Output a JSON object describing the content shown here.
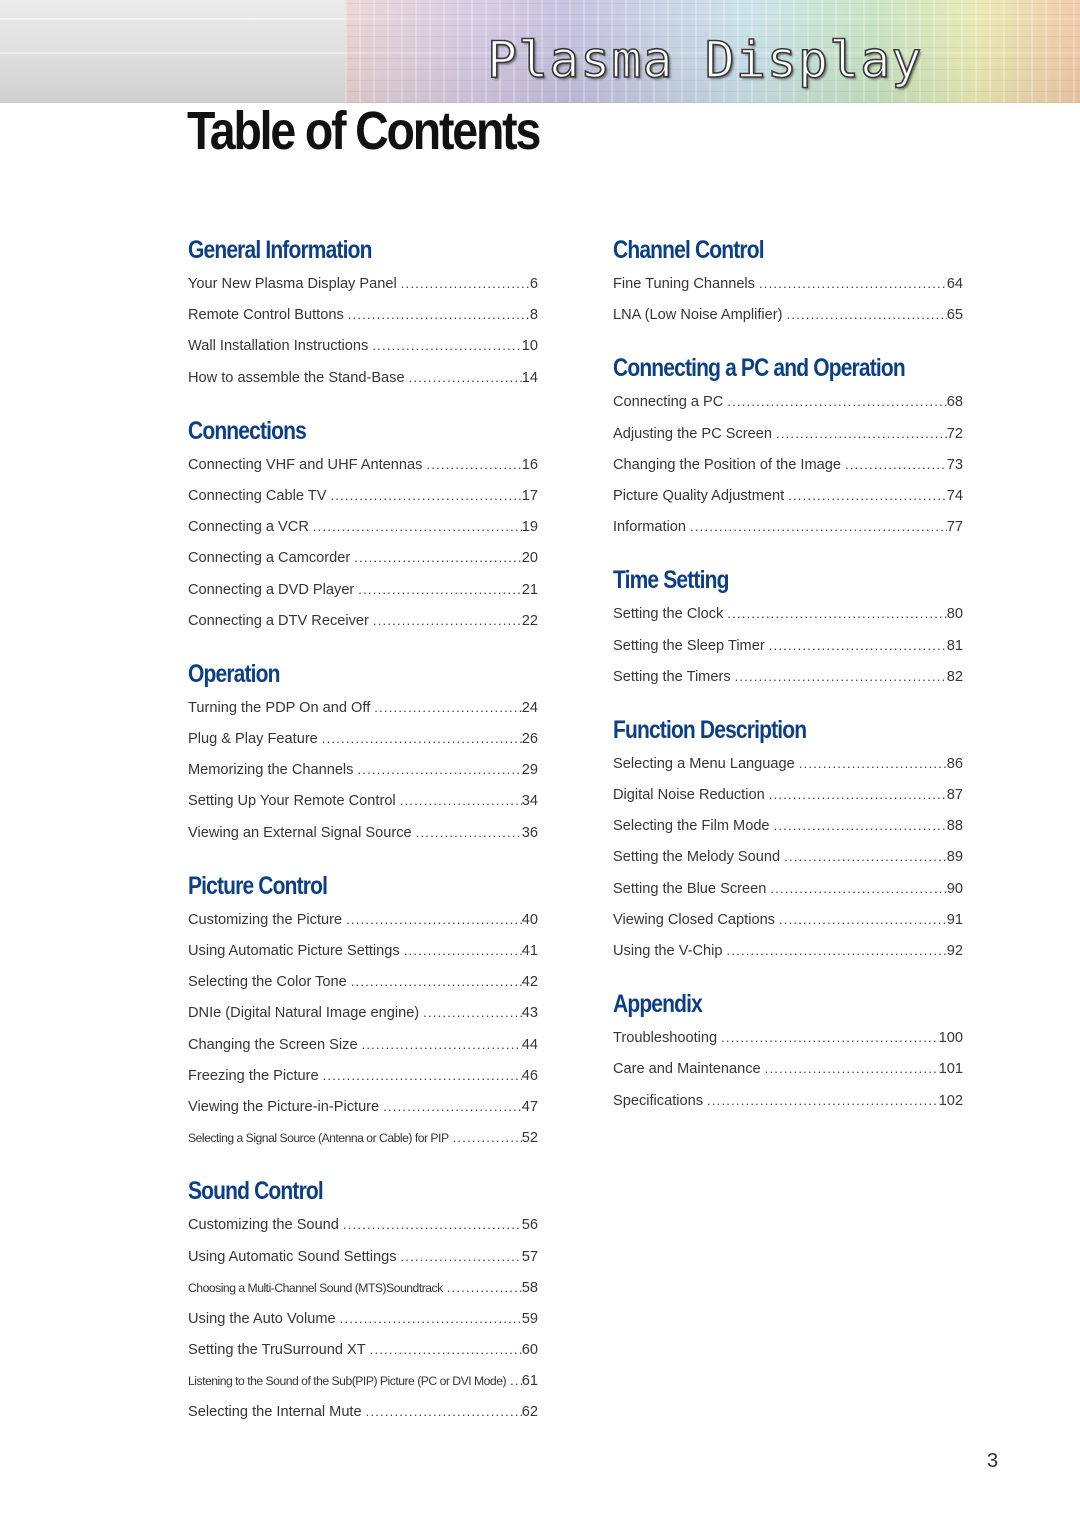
{
  "banner": {
    "title": "Plasma Display"
  },
  "page_title": "Table of Contents",
  "page_number": "3",
  "columns": [
    {
      "sections": [
        {
          "title": "General Information",
          "entries": [
            {
              "label": "Your New Plasma Display Panel",
              "page": "6"
            },
            {
              "label": "Remote Control Buttons",
              "page": "8"
            },
            {
              "label": "Wall Installation Instructions",
              "page": "10"
            },
            {
              "label": "How to assemble the Stand-Base",
              "page": "14"
            }
          ]
        },
        {
          "title": "Connections",
          "entries": [
            {
              "label": "Connecting VHF and UHF Antennas",
              "page": "16"
            },
            {
              "label": "Connecting Cable TV",
              "page": "17"
            },
            {
              "label": "Connecting a VCR",
              "page": "19"
            },
            {
              "label": "Connecting a Camcorder",
              "page": "20"
            },
            {
              "label": "Connecting a DVD Player",
              "page": "21"
            },
            {
              "label": "Connecting a DTV Receiver",
              "page": "22"
            }
          ]
        },
        {
          "title": "Operation",
          "entries": [
            {
              "label": "Turning the PDP On and Off",
              "page": "24"
            },
            {
              "label": "Plug & Play Feature",
              "page": "26"
            },
            {
              "label": "Memorizing the Channels",
              "page": "29"
            },
            {
              "label": "Setting Up Your Remote Control",
              "page": "34"
            },
            {
              "label": "Viewing an External Signal Source",
              "page": "36"
            }
          ]
        },
        {
          "title": "Picture Control",
          "entries": [
            {
              "label": "Customizing the Picture",
              "page": "40"
            },
            {
              "label": "Using Automatic Picture Settings",
              "page": "41"
            },
            {
              "label": "Selecting the Color Tone",
              "page": "42"
            },
            {
              "label": "DNIe (Digital Natural Image engine)",
              "page": "43"
            },
            {
              "label": "Changing the Screen Size",
              "page": "44"
            },
            {
              "label": "Freezing the Picture",
              "page": "46"
            },
            {
              "label": "Viewing the Picture-in-Picture",
              "page": "47"
            },
            {
              "label": "Selecting a Signal Source (Antenna or Cable) for PIP",
              "page": "52"
            }
          ]
        },
        {
          "title": "Sound Control",
          "entries": [
            {
              "label": "Customizing the Sound",
              "page": "56"
            },
            {
              "label": "Using Automatic Sound Settings",
              "page": "57"
            },
            {
              "label": "Choosing a Multi-Channel Sound (MTS)Soundtrack",
              "page": "58"
            },
            {
              "label": "Using the Auto Volume",
              "page": "59"
            },
            {
              "label": "Setting the TruSurround XT",
              "page": "60"
            },
            {
              "label": "Listening to the Sound of the Sub(PIP) Picture (PC or DVI Mode)",
              "page": "61"
            },
            {
              "label": "Selecting the Internal Mute",
              "page": "62"
            }
          ]
        }
      ]
    },
    {
      "sections": [
        {
          "title": "Channel Control",
          "entries": [
            {
              "label": "Fine Tuning Channels",
              "page": "64"
            },
            {
              "label": "LNA (Low Noise Amplifier)",
              "page": "65"
            }
          ]
        },
        {
          "title": "Connecting a PC and Operation",
          "entries": [
            {
              "label": "Connecting a PC",
              "page": "68"
            },
            {
              "label": "Adjusting the PC Screen",
              "page": "72"
            },
            {
              "label": "Changing the Position of the Image",
              "page": "73"
            },
            {
              "label": "Picture Quality Adjustment",
              "page": "74"
            },
            {
              "label": "Information",
              "page": "77"
            }
          ]
        },
        {
          "title": "Time Setting",
          "entries": [
            {
              "label": "Setting the Clock",
              "page": "80"
            },
            {
              "label": "Setting the Sleep Timer",
              "page": "81"
            },
            {
              "label": "Setting the Timers",
              "page": "82"
            }
          ]
        },
        {
          "title": "Function Description",
          "entries": [
            {
              "label": "Selecting a Menu Language",
              "page": "86"
            },
            {
              "label": "Digital Noise Reduction",
              "page": "87"
            },
            {
              "label": "Selecting the Film Mode",
              "page": "88"
            },
            {
              "label": "Setting the Melody Sound",
              "page": "89"
            },
            {
              "label": "Setting the Blue Screen",
              "page": "90"
            },
            {
              "label": "Viewing Closed Captions",
              "page": "91"
            },
            {
              "label": "Using the V-Chip",
              "page": "92"
            }
          ]
        },
        {
          "title": "Appendix",
          "entries": [
            {
              "label": "Troubleshooting",
              "page": "100"
            },
            {
              "label": "Care and Maintenance",
              "page": "101"
            },
            {
              "label": "Specifications",
              "page": "102"
            }
          ]
        }
      ]
    }
  ]
}
